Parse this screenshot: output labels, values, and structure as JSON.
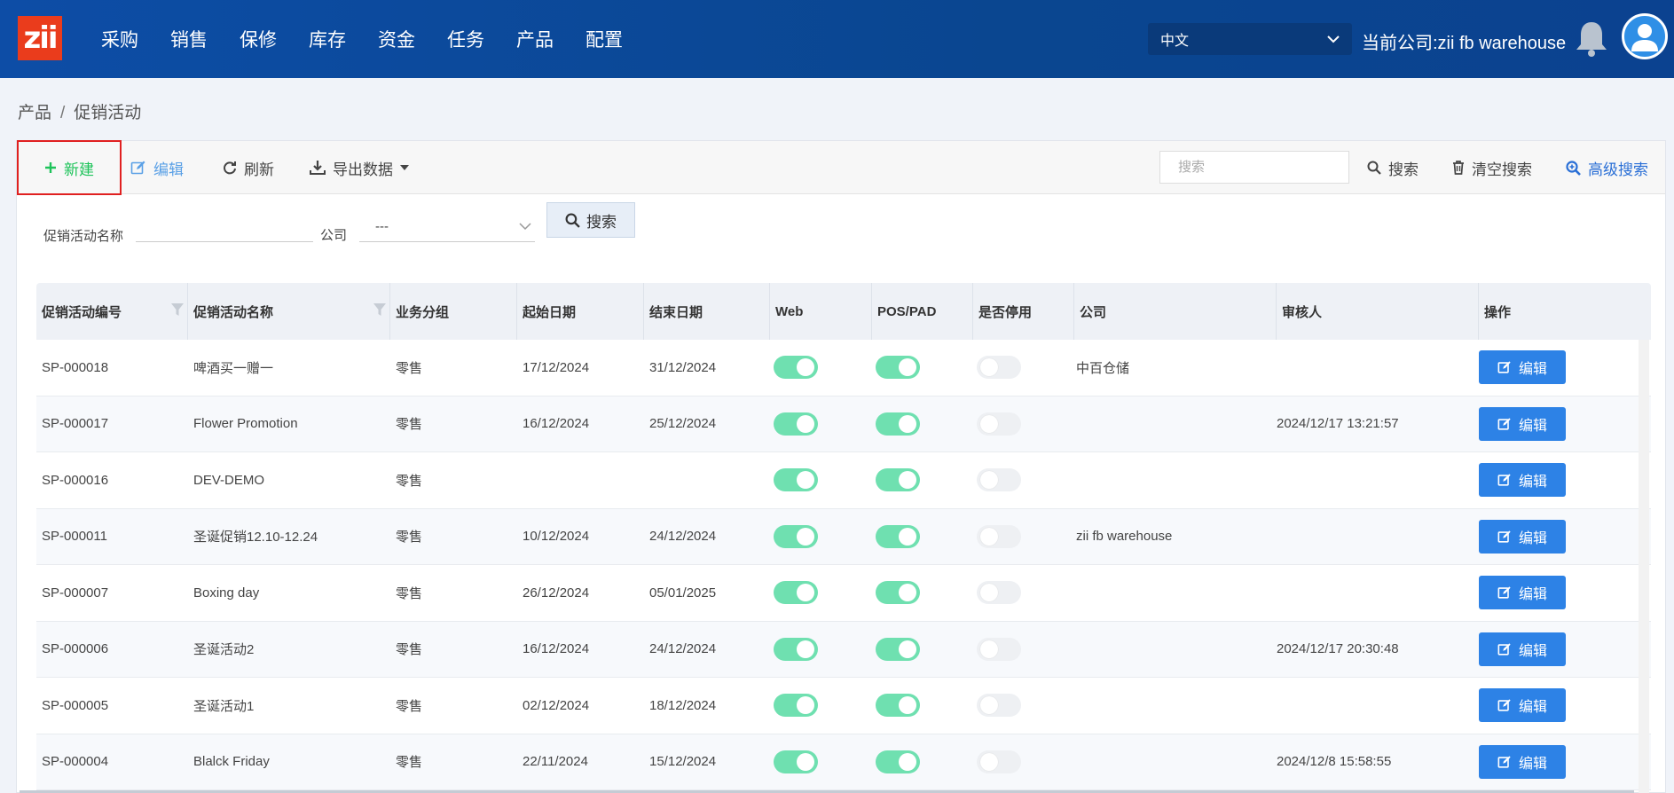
{
  "header": {
    "logo_text": "zii",
    "nav": [
      "采购",
      "销售",
      "保修",
      "库存",
      "资金",
      "任务",
      "产品",
      "配置"
    ],
    "language": "中文",
    "company": "当前公司:zii fb warehouse"
  },
  "breadcrumb": {
    "root": "产品",
    "separator": "/",
    "current": "促销活动"
  },
  "toolbar": {
    "new_label": "新建",
    "edit_label": "编辑",
    "refresh_label": "刷新",
    "export_label": "导出数据",
    "search_placeholder": "搜索",
    "search_label": "搜索",
    "clear_label": "清空搜索",
    "advanced_label": "高级搜索"
  },
  "filters": {
    "name_label": "促销活动名称",
    "company_label": "公司",
    "company_value": "---",
    "search_label": "搜索"
  },
  "table": {
    "columns": [
      "促销活动编号",
      "促销活动名称",
      "业务分组",
      "起始日期",
      "结束日期",
      "Web",
      "POS/PAD",
      "是否停用",
      "公司",
      "审核人",
      "操作"
    ],
    "edit_label": "编辑",
    "rows": [
      {
        "id": "SP-000018",
        "name": "啤酒买一赠一",
        "group": "零售",
        "start": "17/12/2024",
        "end": "31/12/2024",
        "web": true,
        "pos": true,
        "disabled": false,
        "company": "中百仓储",
        "reviewer": ""
      },
      {
        "id": "SP-000017",
        "name": "Flower Promotion",
        "group": "零售",
        "start": "16/12/2024",
        "end": "25/12/2024",
        "web": true,
        "pos": true,
        "disabled": false,
        "company": "",
        "reviewer": "2024/12/17 13:21:57"
      },
      {
        "id": "SP-000016",
        "name": "DEV-DEMO",
        "group": "零售",
        "start": "",
        "end": "",
        "web": true,
        "pos": true,
        "disabled": false,
        "company": "",
        "reviewer": ""
      },
      {
        "id": "SP-000011",
        "name": "圣诞促销12.10-12.24",
        "group": "零售",
        "start": "10/12/2024",
        "end": "24/12/2024",
        "web": true,
        "pos": true,
        "disabled": false,
        "company": "zii fb warehouse",
        "reviewer": ""
      },
      {
        "id": "SP-000007",
        "name": "Boxing day",
        "group": "零售",
        "start": "26/12/2024",
        "end": "05/01/2025",
        "web": true,
        "pos": true,
        "disabled": false,
        "company": "",
        "reviewer": ""
      },
      {
        "id": "SP-000006",
        "name": "圣诞活动2",
        "group": "零售",
        "start": "16/12/2024",
        "end": "24/12/2024",
        "web": true,
        "pos": true,
        "disabled": false,
        "company": "",
        "reviewer": "2024/12/17 20:30:48"
      },
      {
        "id": "SP-000005",
        "name": "圣诞活动1",
        "group": "零售",
        "start": "02/12/2024",
        "end": "18/12/2024",
        "web": true,
        "pos": true,
        "disabled": false,
        "company": "",
        "reviewer": ""
      },
      {
        "id": "SP-000004",
        "name": "Blalck Friday",
        "group": "零售",
        "start": "22/11/2024",
        "end": "15/12/2024",
        "web": true,
        "pos": true,
        "disabled": false,
        "company": "",
        "reviewer": "2024/12/8 15:58:55"
      }
    ]
  },
  "colors": {
    "nav_bg": "#0d4da6",
    "new_green": "#1ec35a",
    "highlight_red": "#e02020",
    "toggle_on": "#6fe0b0",
    "edit_blue": "#2d82e6"
  }
}
